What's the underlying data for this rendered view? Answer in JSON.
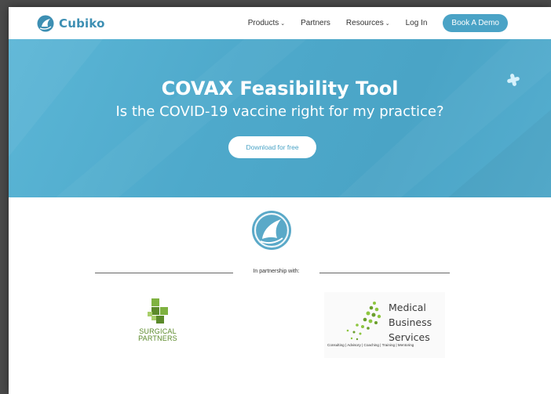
{
  "brand": {
    "name": "Cubiko"
  },
  "nav": {
    "items": [
      {
        "label": "Products",
        "has_dropdown": true
      },
      {
        "label": "Partners",
        "has_dropdown": false
      },
      {
        "label": "Resources",
        "has_dropdown": true
      },
      {
        "label": "Log In",
        "has_dropdown": false
      }
    ],
    "cta_label": "Book A Demo",
    "dropdown_icon": "⌄"
  },
  "hero": {
    "title": "COVAX Feasibility Tool",
    "subtitle": "Is the COVID-19 vaccine right for my practice?",
    "download_label": "Download for free"
  },
  "partnership": {
    "label": "In partnership with:",
    "partners": [
      {
        "name_line1": "SURGICAL",
        "name_line2": "PARTNERS"
      },
      {
        "name_lines": [
          "Medical",
          "Business",
          "Services"
        ],
        "tagline": "Consulting | Advisory | Coaching | Training | Mentoring"
      }
    ]
  },
  "colors": {
    "brand_blue": "#4aa3c6",
    "hero_bg": "#4ea9cb",
    "surgical_green": "#5b8a2a",
    "mbs_green": "#8dc63f"
  },
  "icons": {
    "logo": "cubiko-logo-icon",
    "hero_decor": "plus-icon",
    "emblem": "cubiko-emblem-icon"
  }
}
